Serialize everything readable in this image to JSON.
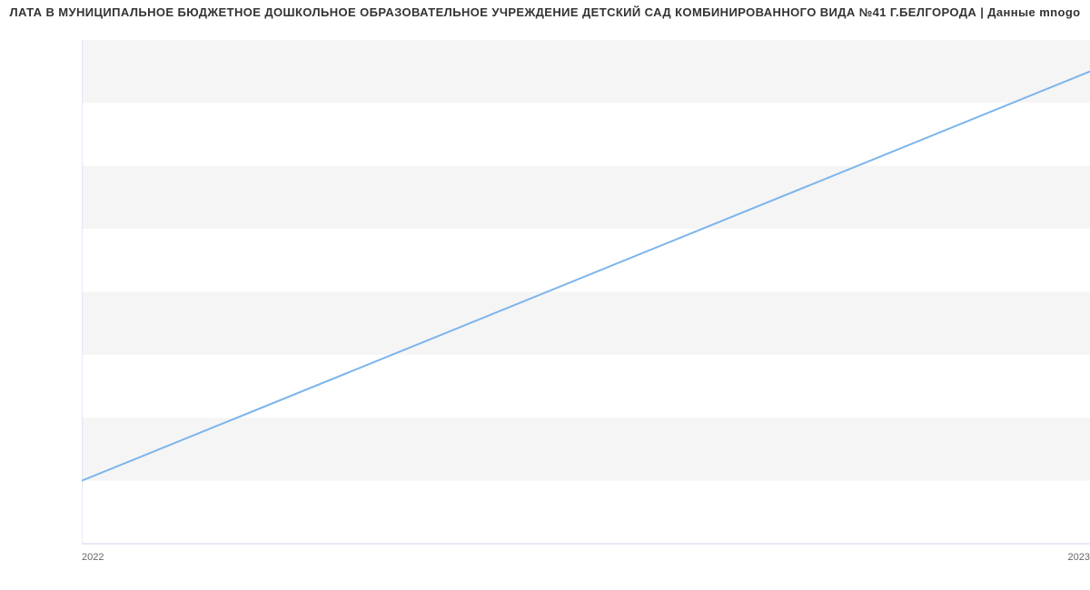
{
  "title": "ЛАТА В МУНИЦИПАЛЬНОЕ БЮДЖЕТНОЕ ДОШКОЛЬНОЕ ОБРАЗОВАТЕЛЬНОЕ УЧРЕЖДЕНИЕ ДЕТСКИЙ САД КОМБИНИРОВАННОГО ВИДА №41 Г.БЕЛГОРОДА | Данные mnogo",
  "chart_data": {
    "type": "line",
    "x": [
      2022,
      2023
    ],
    "y": [
      16000,
      29000
    ],
    "xlim": [
      2022,
      2023
    ],
    "ylim": [
      14000,
      30000
    ],
    "yticks": [
      14000,
      16000,
      18000,
      20000,
      22000,
      24000,
      26000,
      28000,
      30000
    ],
    "xticks": [
      2022,
      2023
    ],
    "line_color": "#7cb5ec",
    "title": "ЛАТА В МУНИЦИПАЛЬНОЕ БЮДЖЕТНОЕ ДОШКОЛЬНОЕ ОБРАЗОВАТЕЛЬНОЕ УЧРЕЖДЕНИЕ ДЕТСКИЙ САД КОМБИНИРОВАННОГО ВИДА №41 Г.БЕЛГОРОДА | Данные mnogo",
    "xlabel": "",
    "ylabel": ""
  }
}
